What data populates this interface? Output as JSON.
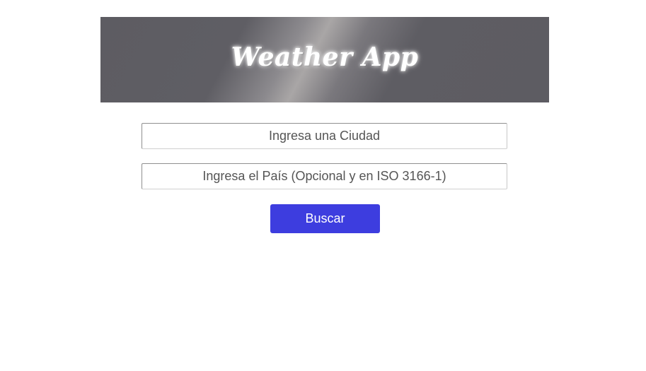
{
  "header": {
    "title": "Weather App"
  },
  "form": {
    "city_placeholder": "Ingresa una Ciudad",
    "city_value": "",
    "country_placeholder": "Ingresa el País (Opcional y en ISO 3166-1)",
    "country_value": "",
    "search_label": "Buscar"
  },
  "colors": {
    "button": "#3d3ddf",
    "header_base": "#5d5c62"
  }
}
